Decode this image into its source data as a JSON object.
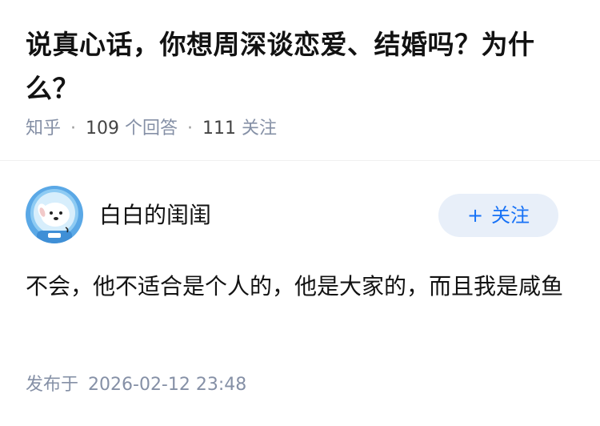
{
  "question": {
    "title": "说真心话，你想周深谈恋爱、结婚吗？为什么？",
    "source": "知乎",
    "answer_count": "109",
    "answer_label": "个回答",
    "follower_count": "111",
    "follower_label": "关注"
  },
  "author": {
    "name": "白白的闺闺",
    "avatar_icon": "dog-astronaut-avatar",
    "follow_label": "关注"
  },
  "answer": {
    "text": "不会，他不适合是个人的，他是大家的，而且我是咸鱼",
    "published_label": "发布于",
    "published_time": "2026-02-12 23:48"
  },
  "colors": {
    "accent": "#1772f6",
    "follow_bg": "#e8eff9",
    "meta": "#8590a6",
    "text": "#121212"
  }
}
